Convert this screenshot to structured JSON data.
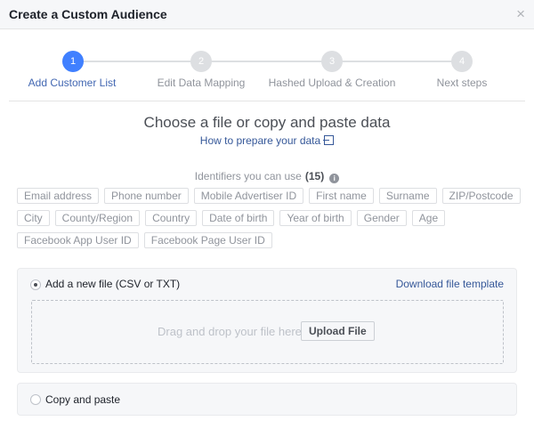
{
  "header": {
    "title": "Create a Custom Audience",
    "close_glyph": "×"
  },
  "stepper": {
    "active_step": 1,
    "steps": [
      {
        "number": "1",
        "label": "Add Customer List"
      },
      {
        "number": "2",
        "label": "Edit Data Mapping"
      },
      {
        "number": "3",
        "label": "Hashed Upload & Creation"
      },
      {
        "number": "4",
        "label": "Next steps"
      }
    ]
  },
  "main": {
    "title": "Choose a file or copy and paste data",
    "help_link": "How to prepare your data"
  },
  "identifiers": {
    "label": "Identifiers you can use",
    "count": "(15)",
    "info_glyph": "i",
    "rows": [
      [
        "Email address",
        "Phone number",
        "Mobile Advertiser ID",
        "First name",
        "Surname",
        "ZIP/Postcode"
      ],
      [
        "City",
        "County/Region",
        "Country",
        "Date of birth",
        "Year of birth",
        "Gender",
        "Age"
      ],
      [
        "Facebook App User ID",
        "Facebook Page User ID"
      ]
    ]
  },
  "upload": {
    "option_label": "Add a new file (CSV or TXT)",
    "selected": true,
    "template_link": "Download file template",
    "drop_text": "Drag and drop your file here or",
    "upload_button": "Upload File"
  },
  "paste": {
    "option_label": "Copy and paste",
    "selected": false
  },
  "colors": {
    "accent": "#4080ff",
    "link": "#365899",
    "inactive": "#dddfe2"
  }
}
